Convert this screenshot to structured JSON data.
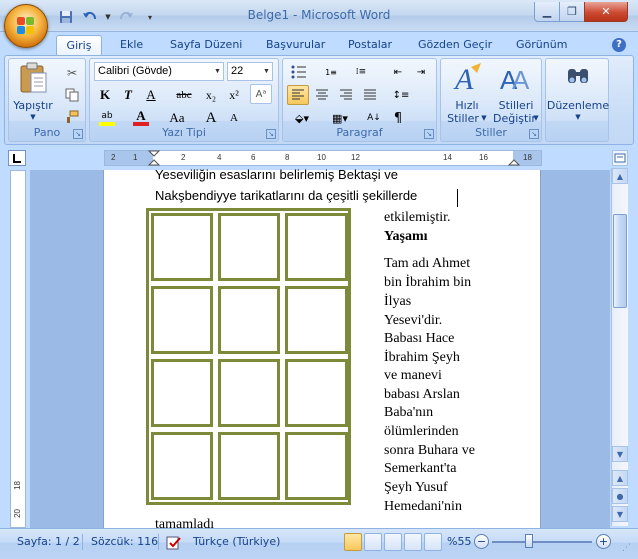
{
  "window": {
    "title": "Belge1 - Microsoft Word",
    "minimize_icon": "minimize-icon",
    "maximize_icon": "restore-icon",
    "close_icon": "close-icon"
  },
  "quick_access": [
    "save-icon",
    "undo-icon",
    "redo-icon",
    "customize-icon"
  ],
  "tabs": [
    {
      "label": "Giriş",
      "active": true
    },
    {
      "label": "Ekle"
    },
    {
      "label": "Sayfa Düzeni"
    },
    {
      "label": "Başvurular"
    },
    {
      "label": "Postalar"
    },
    {
      "label": "Gözden Geçir"
    },
    {
      "label": "Görünüm"
    }
  ],
  "ribbon": {
    "pano": {
      "label": "Pano",
      "paste_label": "Yapıştır"
    },
    "font": {
      "label": "Yazı Tipi",
      "font_name": "Calibri (Gövde)",
      "font_size": "22",
      "bold": "K",
      "italic": "T",
      "underline": "A",
      "strikethrough": "abc",
      "subscript": "x₂",
      "superscript": "x²",
      "change_case": "Aa",
      "grow": "A",
      "shrink": "A",
      "highlight": "ab",
      "font_color": "A"
    },
    "paragraph": {
      "label": "Paragraf"
    },
    "styles": {
      "label": "Stiller",
      "quick_styles": "Hızlı",
      "quick_styles_2": "Stiller",
      "change_styles": "Stilleri",
      "change_styles_2": "Değiştir"
    },
    "editing": {
      "label": "Düzenleme"
    }
  },
  "ruler": {
    "h_ticks": [
      "2",
      "1",
      "2",
      "4",
      "6",
      "8",
      "10",
      "12",
      "14",
      "16",
      "18"
    ],
    "v_ticks": [
      "18",
      "20"
    ]
  },
  "document": {
    "line1": "Yeseviliğin esaslarını belirlemiş Bektaşi ve",
    "line2": "Nakşbendiyye  tarikatlarını da çeşitli şekillerde",
    "side_lines": [
      "etkilemiştir.",
      "Yaşamı",
      "Tam adı Ahmet",
      "bin İbrahim bin",
      "İlyas",
      "Yesevi'dir.",
      "Babası Hace",
      "İbrahim Şeyh",
      "ve manevi",
      "babası Arslan",
      "Baba'nın",
      "ölümlerinden",
      "sonra Buhara ve",
      "Semerkant'ta",
      "Şeyh Yusuf",
      "Hemedani'nin"
    ],
    "bottom_line": "tamamladı"
  },
  "statusbar": {
    "page": "Sayfa: 1 / 2",
    "words": "Sözcük: 116",
    "language": "Türkçe (Türkiye)",
    "zoom": "%55",
    "zoom_level": 0.55
  },
  "colors": {
    "table_border": "#7d8a3a",
    "ribbon_bg": "#c7dcf6",
    "doc_bg": "#9bbbe6"
  }
}
